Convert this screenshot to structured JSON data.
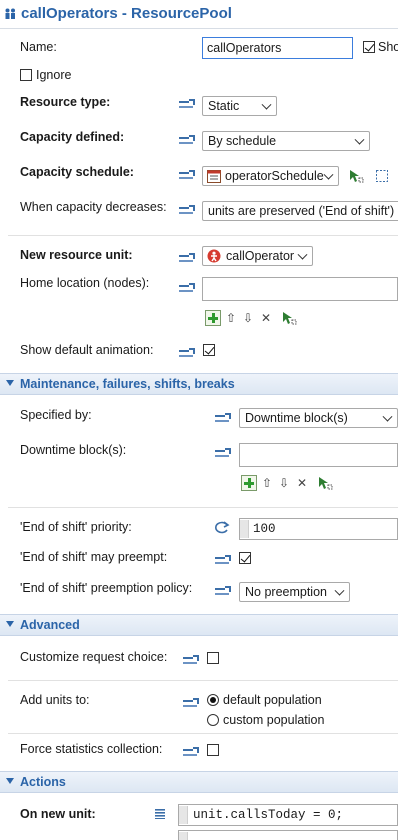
{
  "header": {
    "title": "callOperators - ResourcePool",
    "icon": "agents-icon"
  },
  "name_row": {
    "label": "Name:",
    "value": "callOperators",
    "show_label": "Sho",
    "show_checked": true
  },
  "ignore": {
    "label": "Ignore",
    "checked": false
  },
  "resource_type": {
    "label": "Resource type:",
    "value": "Static"
  },
  "capacity_defined": {
    "label": "Capacity defined:",
    "value": "By schedule"
  },
  "capacity_schedule": {
    "label": "Capacity schedule:",
    "value": "operatorSchedule"
  },
  "capacity_decreases": {
    "label": "When capacity decreases:",
    "value": "units are preserved ('End of shift')"
  },
  "new_resource_unit": {
    "label": "New resource unit:",
    "value": "callOperator"
  },
  "home_location": {
    "label": "Home location (nodes):",
    "value": ""
  },
  "show_animation": {
    "label": "Show default animation:",
    "checked": true
  },
  "section_maintenance": {
    "title": "Maintenance, failures, shifts, breaks"
  },
  "specified_by": {
    "label": "Specified by:",
    "value": "Downtime block(s)"
  },
  "downtime_blocks": {
    "label": "Downtime block(s):",
    "value": ""
  },
  "eos_priority": {
    "label": "'End of shift' priority:",
    "value": "100"
  },
  "eos_preempt": {
    "label": "'End of shift' may preempt:",
    "checked": true
  },
  "eos_policy": {
    "label": "'End of shift' preemption policy:",
    "value": "No preemption"
  },
  "section_advanced": {
    "title": "Advanced"
  },
  "customize_request": {
    "label": "Customize request choice:",
    "checked": false
  },
  "add_units": {
    "label": "Add units to:",
    "options": [
      "default population",
      "custom population"
    ],
    "selected": 0
  },
  "force_stats": {
    "label": "Force statistics collection:",
    "checked": false
  },
  "section_actions": {
    "title": "Actions"
  },
  "on_new_unit": {
    "label": "On new unit:",
    "code": "unit.callsToday = 0;"
  },
  "colors": {
    "accent": "#2b64a8",
    "section_bg": "#dde7f3",
    "focus_border": "#3b7ddd"
  }
}
